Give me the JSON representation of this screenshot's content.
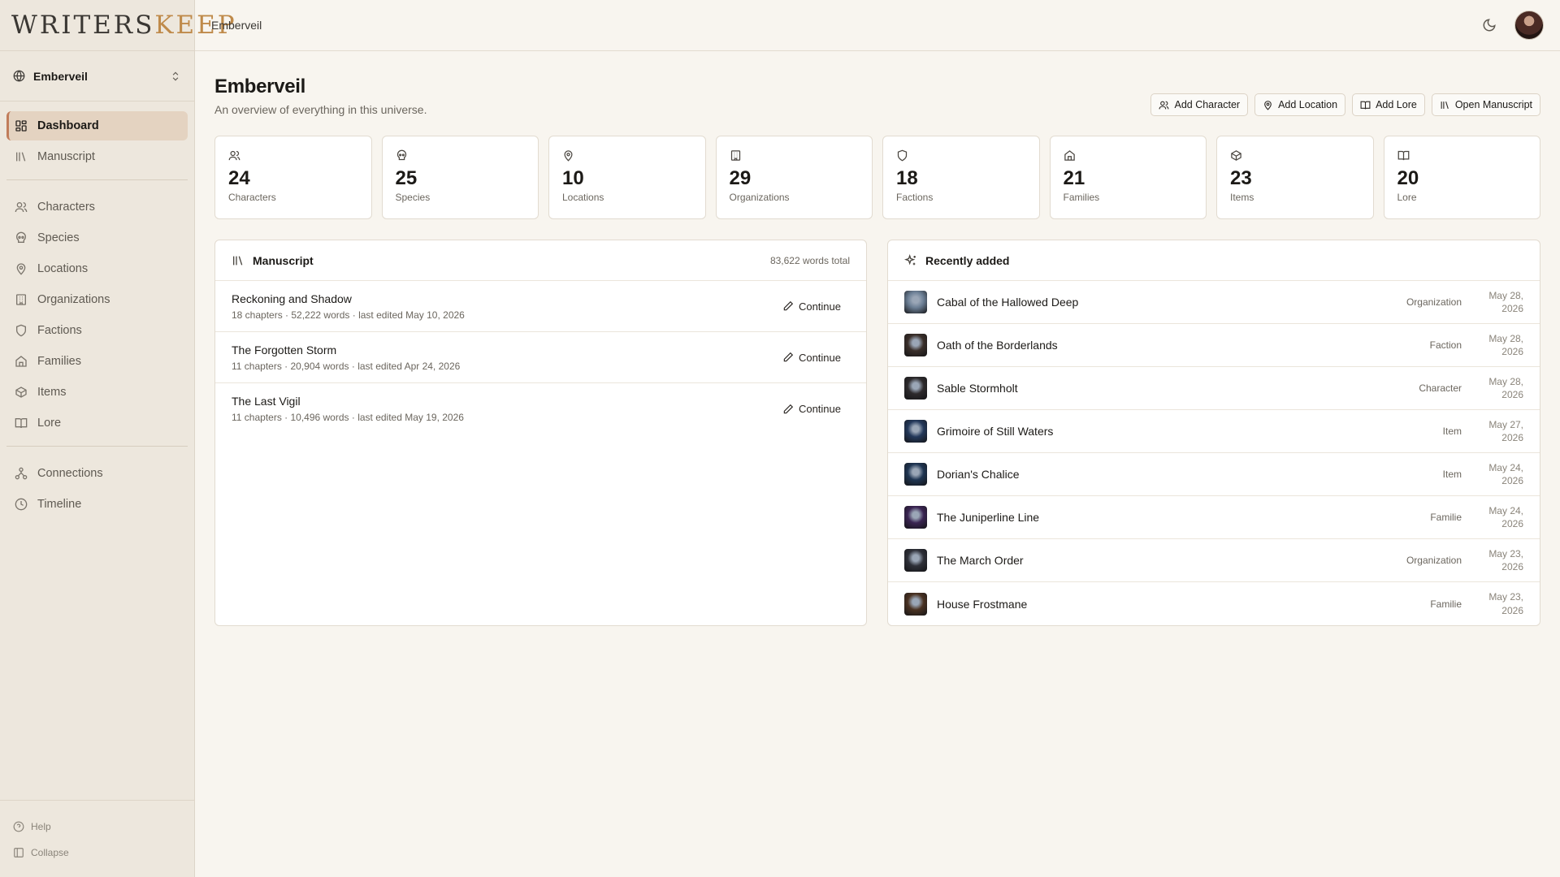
{
  "app": {
    "logo_part1": "WRITERS",
    "logo_part2": "KEEP"
  },
  "universe": {
    "name": "Emberveil"
  },
  "sidebar": {
    "items": [
      {
        "label": "Dashboard",
        "icon": "dashboard-icon",
        "active": true
      },
      {
        "label": "Manuscript",
        "icon": "library-icon"
      },
      {
        "label": "Characters",
        "icon": "users-icon"
      },
      {
        "label": "Species",
        "icon": "skull-icon"
      },
      {
        "label": "Locations",
        "icon": "map-pin-icon"
      },
      {
        "label": "Organizations",
        "icon": "building-icon"
      },
      {
        "label": "Factions",
        "icon": "shield-icon"
      },
      {
        "label": "Families",
        "icon": "home-icon"
      },
      {
        "label": "Items",
        "icon": "box-icon"
      },
      {
        "label": "Lore",
        "icon": "book-icon"
      },
      {
        "label": "Connections",
        "icon": "network-icon"
      },
      {
        "label": "Timeline",
        "icon": "clock-icon"
      }
    ],
    "help_label": "Help",
    "collapse_label": "Collapse"
  },
  "topbar": {
    "breadcrumb": "Emberveil"
  },
  "header": {
    "title": "Emberveil",
    "subtitle": "An overview of everything in this universe."
  },
  "actions": {
    "add_character": "Add Character",
    "add_location": "Add Location",
    "add_lore": "Add Lore",
    "open_manuscript": "Open Manuscript"
  },
  "stats": [
    {
      "value": "24",
      "label": "Characters",
      "icon": "users-icon"
    },
    {
      "value": "25",
      "label": "Species",
      "icon": "skull-icon"
    },
    {
      "value": "10",
      "label": "Locations",
      "icon": "map-pin-icon"
    },
    {
      "value": "29",
      "label": "Organizations",
      "icon": "building-icon"
    },
    {
      "value": "18",
      "label": "Factions",
      "icon": "shield-icon"
    },
    {
      "value": "21",
      "label": "Families",
      "icon": "home-icon"
    },
    {
      "value": "23",
      "label": "Items",
      "icon": "box-icon"
    },
    {
      "value": "20",
      "label": "Lore",
      "icon": "book-icon"
    }
  ],
  "manuscript": {
    "title": "Manuscript",
    "total": "83,622 words total",
    "continue_label": "Continue",
    "books": [
      {
        "title": "Reckoning and Shadow",
        "meta": "18 chapters · 52,222 words · last edited May 10, 2026"
      },
      {
        "title": "The Forgotten Storm",
        "meta": "11 chapters · 20,904 words · last edited Apr 24, 2026"
      },
      {
        "title": "The Last Vigil",
        "meta": "11 chapters · 10,496 words · last edited May 19, 2026"
      }
    ]
  },
  "recent": {
    "title": "Recently added",
    "items": [
      {
        "name": "Cabal of the Hallowed Deep",
        "type": "Organization",
        "date_line1": "May 28,",
        "date_line2": "2026",
        "color": "#6b7e94"
      },
      {
        "name": "Oath of the Borderlands",
        "type": "Faction",
        "date_line1": "May 28,",
        "date_line2": "2026",
        "color": "#3a2f2a"
      },
      {
        "name": "Sable Stormholt",
        "type": "Character",
        "date_line1": "May 28,",
        "date_line2": "2026",
        "color": "#2d2a2c"
      },
      {
        "name": "Grimoire of Still Waters",
        "type": "Item",
        "date_line1": "May 27,",
        "date_line2": "2026",
        "color": "#23385a"
      },
      {
        "name": "Dorian's Chalice",
        "type": "Item",
        "date_line1": "May 24,",
        "date_line2": "2026",
        "color": "#1f3552"
      },
      {
        "name": "The Juniperline Line",
        "type": "Familie",
        "date_line1": "May 24,",
        "date_line2": "2026",
        "color": "#3a2452"
      },
      {
        "name": "The March Order",
        "type": "Organization",
        "date_line1": "May 23,",
        "date_line2": "2026",
        "color": "#2e3038"
      },
      {
        "name": "House Frostmane",
        "type": "Familie",
        "date_line1": "May 23,",
        "date_line2": "2026",
        "color": "#4a3222"
      }
    ]
  }
}
